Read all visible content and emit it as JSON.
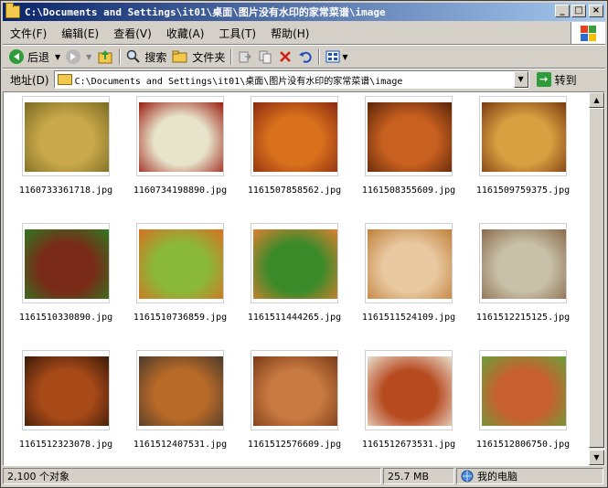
{
  "window": {
    "title": "C:\\Documents and Settings\\it01\\桌面\\图片没有水印的家常菜谱\\image",
    "minimize": "_",
    "maximize": "□",
    "close": "×"
  },
  "menubar": {
    "items": [
      {
        "label": "文件(F)"
      },
      {
        "label": "编辑(E)"
      },
      {
        "label": "查看(V)"
      },
      {
        "label": "收藏(A)"
      },
      {
        "label": "工具(T)"
      },
      {
        "label": "帮助(H)"
      }
    ]
  },
  "toolbar": {
    "back_label": "后退",
    "search_label": "搜索",
    "folders_label": "文件夹"
  },
  "address": {
    "label": "地址(D)",
    "value": "C:\\Documents and Settings\\it01\\桌面\\图片没有水印的家常菜谱\\image",
    "go_label": "转到"
  },
  "files": [
    {
      "name": "1160733361718.jpg",
      "colors": [
        "#c8a84a",
        "#7a6a22"
      ]
    },
    {
      "name": "1160734198890.jpg",
      "colors": [
        "#e8e4cc",
        "#9a1c10"
      ]
    },
    {
      "name": "1161507858562.jpg",
      "colors": [
        "#d8701c",
        "#8a2a10"
      ]
    },
    {
      "name": "1161508355609.jpg",
      "colors": [
        "#c86020",
        "#5a2408"
      ]
    },
    {
      "name": "1161509759375.jpg",
      "colors": [
        "#d8a040",
        "#7a3a10"
      ]
    },
    {
      "name": "1161510330890.jpg",
      "colors": [
        "#7a2a18",
        "#2e7a22"
      ]
    },
    {
      "name": "1161510736859.jpg",
      "colors": [
        "#8ab83a",
        "#d87020"
      ]
    },
    {
      "name": "1161511444265.jpg",
      "colors": [
        "#3a8a2a",
        "#e08030"
      ]
    },
    {
      "name": "1161511524109.jpg",
      "colors": [
        "#e8c8a0",
        "#c0803a"
      ]
    },
    {
      "name": "1161512215125.jpg",
      "colors": [
        "#c8c0a8",
        "#8a6a4a"
      ]
    },
    {
      "name": "1161512323078.jpg",
      "colors": [
        "#a84a18",
        "#3a1a08"
      ]
    },
    {
      "name": "1161512407531.jpg",
      "colors": [
        "#b86a28",
        "#4a3a2a"
      ]
    },
    {
      "name": "1161512576609.jpg",
      "colors": [
        "#c87a40",
        "#7a3a18"
      ]
    },
    {
      "name": "1161512673531.jpg",
      "colors": [
        "#b84a20",
        "#e8e0d0"
      ]
    },
    {
      "name": "1161512806750.jpg",
      "colors": [
        "#c86030",
        "#6aa03a"
      ]
    }
  ],
  "status": {
    "objects": "2,100 个对象",
    "size": "25.7 MB",
    "location": "我的电脑"
  }
}
